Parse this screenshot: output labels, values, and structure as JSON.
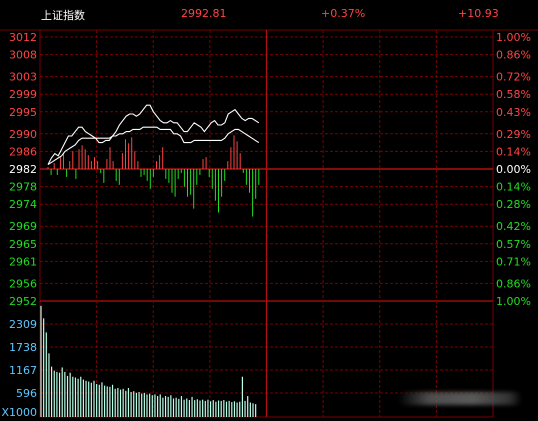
{
  "header": {
    "index_name": "上证指数",
    "price": "2992.81",
    "change_pct": "+0.37%",
    "change": "+10.93"
  },
  "colors": {
    "up": "#ff4444",
    "down": "#22dd22",
    "grid": "#7a0000",
    "price_line": "#ffffff",
    "avg_line": "#ffffff",
    "volume": "#b8ffe8",
    "volume_axis": "#5ec8ff",
    "neutral": "#ffffff"
  },
  "chart_data": [
    {
      "type": "line",
      "title": "",
      "preclose": 2982,
      "ylim": [
        2952,
        3012
      ],
      "left_ticks": [
        {
          "label": "3012",
          "value": 3012,
          "dir": "up"
        },
        {
          "label": "3008",
          "value": 3008,
          "dir": "up"
        },
        {
          "label": "3003",
          "value": 3003,
          "dir": "up"
        },
        {
          "label": "2999",
          "value": 2999,
          "dir": "up"
        },
        {
          "label": "2995",
          "value": 2995,
          "dir": "up"
        },
        {
          "label": "2990",
          "value": 2990,
          "dir": "up"
        },
        {
          "label": "2986",
          "value": 2986,
          "dir": "up"
        },
        {
          "label": "2982",
          "value": 2982,
          "dir": "flat"
        },
        {
          "label": "2978",
          "value": 2978,
          "dir": "down"
        },
        {
          "label": "2974",
          "value": 2974,
          "dir": "down"
        },
        {
          "label": "2969",
          "value": 2969,
          "dir": "down"
        },
        {
          "label": "2965",
          "value": 2965,
          "dir": "down"
        },
        {
          "label": "2961",
          "value": 2961,
          "dir": "down"
        },
        {
          "label": "2956",
          "value": 2956,
          "dir": "down"
        },
        {
          "label": "2952",
          "value": 2952,
          "dir": "down"
        }
      ],
      "right_ticks": [
        {
          "label": "1.00%",
          "value": 3012,
          "dir": "up"
        },
        {
          "label": "0.86%",
          "value": 3008,
          "dir": "up"
        },
        {
          "label": "0.72%",
          "value": 3003,
          "dir": "up"
        },
        {
          "label": "0.58%",
          "value": 2999,
          "dir": "up"
        },
        {
          "label": "0.43%",
          "value": 2995,
          "dir": "up"
        },
        {
          "label": "0.29%",
          "value": 2990,
          "dir": "up"
        },
        {
          "label": "0.14%",
          "value": 2986,
          "dir": "up"
        },
        {
          "label": "0.00%",
          "value": 2982,
          "dir": "flat"
        },
        {
          "label": "0.14%",
          "value": 2978,
          "dir": "down"
        },
        {
          "label": "0.28%",
          "value": 2974,
          "dir": "down"
        },
        {
          "label": "0.42%",
          "value": 2969,
          "dir": "down"
        },
        {
          "label": "0.57%",
          "value": 2965,
          "dir": "down"
        },
        {
          "label": "0.71%",
          "value": 2961,
          "dir": "down"
        },
        {
          "label": "0.86%",
          "value": 2956,
          "dir": "down"
        },
        {
          "label": "1.00%",
          "value": 2952,
          "dir": "down"
        }
      ],
      "total_minutes": 240,
      "price": [
        2983.0,
        2984.5,
        2985.5,
        2985.0,
        2986.5,
        2988.0,
        2989.5,
        2989.5,
        2990.5,
        2991.5,
        2991.5,
        2990.5,
        2990.0,
        2989.5,
        2989.0,
        2988.0,
        2988.0,
        2988.5,
        2988.5,
        2989.5,
        2990.5,
        2992.0,
        2993.0,
        2994.0,
        2994.5,
        2994.5,
        2994.0,
        2994.5,
        2995.5,
        2996.5,
        2996.5,
        2995.0,
        2994.0,
        2993.0,
        2992.5,
        2992.5,
        2993.0,
        2992.5,
        2992.5,
        2991.5,
        2990.5,
        2990.5,
        2991.5,
        2992.5,
        2992.0,
        2991.5,
        2990.5,
        2991.5,
        2992.5,
        2993.0,
        2992.0,
        2992.0,
        2992.5,
        2994.5,
        2995.0,
        2995.5,
        2994.5,
        2993.5,
        2993.0,
        2993.5,
        2993.5,
        2993.0,
        2992.5
      ],
      "avg": [
        2983.0,
        2983.5,
        2984.0,
        2984.5,
        2985.0,
        2986.0,
        2986.5,
        2987.0,
        2987.5,
        2988.5,
        2989.0,
        2989.0,
        2989.0,
        2989.0,
        2989.0,
        2989.0,
        2989.0,
        2989.0,
        2989.0,
        2989.5,
        2989.5,
        2990.0,
        2990.0,
        2990.5,
        2990.5,
        2991.0,
        2991.0,
        2991.0,
        2991.5,
        2991.5,
        2991.5,
        2991.5,
        2991.5,
        2991.0,
        2991.0,
        2991.0,
        2991.0,
        2990.0,
        2990.0,
        2989.5,
        2988.0,
        2988.0,
        2988.0,
        2988.5,
        2988.5,
        2988.5,
        2988.5,
        2988.5,
        2988.5,
        2988.5,
        2988.5,
        2988.5,
        2989.0,
        2990.0,
        2990.5,
        2991.0,
        2991.0,
        2990.5,
        2990.0,
        2989.5,
        2989.0,
        2988.5,
        2988.0
      ],
      "momentum": [
        0.5,
        -1.5,
        1.5,
        -1.5,
        3.0,
        4.0,
        -2.0,
        2.0,
        4.5,
        -2.5,
        5.0,
        6.0,
        5.0,
        3.5,
        2.0,
        3.0,
        2.0,
        -1.0,
        -3.5,
        2.5,
        5.5,
        2.0,
        -3.0,
        -4.0,
        4.0,
        7.5,
        6.5,
        8.0,
        4.5,
        2.0,
        -2.0,
        -1.5,
        -3.0,
        -5.0,
        -2.0,
        2.0,
        3.5,
        5.5,
        -2.5,
        -3.5,
        -6.0,
        -7.0,
        -2.5,
        -1.0,
        -4.5,
        -7.0,
        -6.5,
        -10.0,
        -4.0,
        -1.5,
        2.5,
        3.0,
        -2.0,
        -5.0,
        -8.0,
        -11.0,
        -7.0,
        -3.0,
        2.0,
        5.5,
        8.5,
        7.0,
        4.0,
        -1.0,
        -4.0,
        -6.0,
        -12.0,
        -7.5,
        -4.0
      ]
    },
    {
      "type": "bar",
      "title": "",
      "ylabel_multiplier": "X1000",
      "ylim": [
        0,
        2880
      ],
      "ticks": [
        {
          "label": "2309",
          "value": 2309
        },
        {
          "label": "1738",
          "value": 1738
        },
        {
          "label": "1167",
          "value": 1167
        },
        {
          "label": "596",
          "value": 596
        }
      ],
      "values": [
        2760,
        2450,
        2100,
        1580,
        1250,
        1150,
        1120,
        1100,
        1230,
        1120,
        1020,
        1100,
        1000,
        980,
        950,
        1000,
        930,
        900,
        880,
        850,
        900,
        820,
        800,
        860,
        780,
        760,
        750,
        800,
        700,
        720,
        680,
        700,
        650,
        720,
        620,
        640,
        600,
        620,
        580,
        600,
        560,
        580,
        540,
        560,
        520,
        560,
        480,
        520,
        500,
        540,
        460,
        480,
        450,
        520,
        430,
        460,
        420,
        500,
        420,
        440,
        410,
        430,
        400,
        430,
        390,
        420,
        380,
        410,
        400,
        420,
        380,
        400,
        370,
        390,
        360,
        380,
        1000,
        400,
        520,
        360,
        340,
        320
      ]
    }
  ]
}
